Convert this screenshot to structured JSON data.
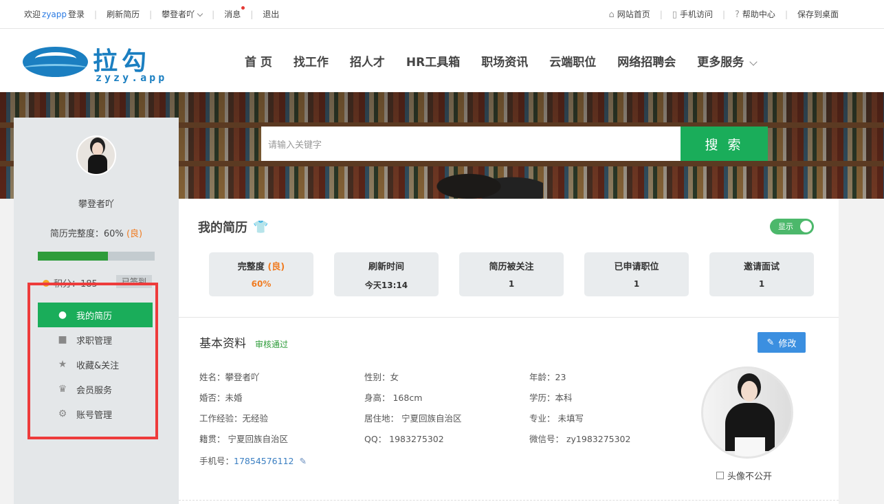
{
  "topbar": {
    "welcome": "欢迎",
    "username": "zyapp",
    "login": "登录",
    "refresh_resume": "刷新简历",
    "user_menu": "攀登者吖",
    "messages": "消息",
    "logout": "退出",
    "home": "网站首页",
    "mobile": "手机访问",
    "help": "帮助中心",
    "save_desktop": "保存到桌面"
  },
  "logo": {
    "cn": "拉勾",
    "en": "zyzy.app"
  },
  "nav": [
    "首 页",
    "找工作",
    "招人才",
    "HR工具箱",
    "职场资讯",
    "云端职位",
    "网络招聘会",
    "更多服务"
  ],
  "search": {
    "placeholder": "请输入关键字",
    "button": "搜 索"
  },
  "sidebar": {
    "name": "攀登者吖",
    "completeness_label": "简历完整度：60%",
    "completeness_grade": "(良)",
    "completeness_value": 0.6,
    "points": "积分：185",
    "signed": "已签到",
    "menu": [
      {
        "label": "我的简历",
        "icon": "person-icon"
      },
      {
        "label": "求职管理",
        "icon": "briefcase-icon"
      },
      {
        "label": "收藏&关注",
        "icon": "star-icon"
      },
      {
        "label": "会员服务",
        "icon": "crown-icon"
      },
      {
        "label": "账号管理",
        "icon": "gear-icon"
      }
    ]
  },
  "main": {
    "title": "我的简历",
    "toggle_label": "显示",
    "stats": [
      {
        "label": "完整度",
        "grade": "(良)",
        "value": "60%"
      },
      {
        "label": "刷新时间",
        "value": "今天13:14"
      },
      {
        "label": "简历被关注",
        "value": "1"
      },
      {
        "label": "已申请职位",
        "value": "1"
      },
      {
        "label": "邀请面试",
        "value": "1"
      }
    ],
    "basic": {
      "title": "基本资料",
      "status": "审核通过",
      "edit": "修改",
      "name": "姓名：攀登者吖",
      "gender": "性别：女",
      "age": "年龄：23",
      "marital": "婚否：未婚",
      "height": "身高： 168cm",
      "education": "学历：本科",
      "experience": "工作经验：无经验",
      "residence": "居住地： 宁夏回族自治区",
      "major": "专业： 未填写",
      "hometown": "籍贯： 宁夏回族自治区",
      "qq": "QQ： 1983275302",
      "wechat": "微信号： zy1983275302",
      "phone_label": "手机号：",
      "phone": "17854576112",
      "hide_avatar": "头像不公开"
    }
  },
  "colors": {
    "accent": "#1aad5a",
    "orange": "#f07c22",
    "blue": "#3b8fe0",
    "highlight": "#ee3b3b"
  }
}
